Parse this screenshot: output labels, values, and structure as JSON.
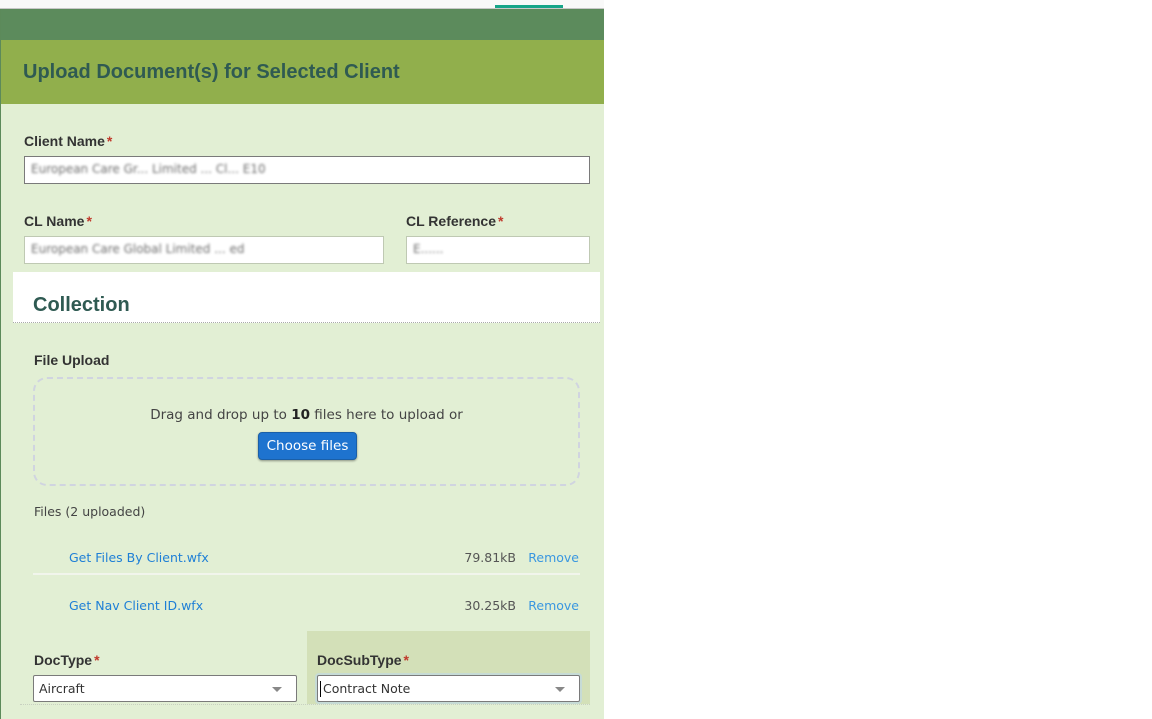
{
  "header": {
    "title": "Upload Document(s) for Selected Client"
  },
  "client": {
    "client_name_label": "Client Name",
    "client_name_value": "European Care Gr... Limited ... Cl... E10",
    "cl_name_label": "CL Name",
    "cl_name_value": "European Care Global Limited ... ed",
    "cl_reference_label": "CL Reference",
    "cl_reference_value": "E......",
    "required_marker": "*"
  },
  "collection": {
    "title": "Collection",
    "file_upload_label": "File Upload",
    "dropzone": {
      "text_before": "Drag and drop up to ",
      "max_files": "10",
      "text_after": " files here to upload or",
      "button_label": "Choose files"
    },
    "files_count_label": "Files (2 uploaded)",
    "files": [
      {
        "name": "Get Files By Client.wfx",
        "size": "79.81kB",
        "action": "Remove"
      },
      {
        "name": "Get Nav Client ID.wfx",
        "size": "30.25kB",
        "action": "Remove"
      }
    ]
  },
  "doc": {
    "doctype_label": "DocType",
    "doctype_value": "Aircraft",
    "docsubtype_label": "DocSubType",
    "docsubtype_value": "Contract Note"
  },
  "colors": {
    "header_dark": "#5c8b5c",
    "header_accent": "#91af4c",
    "panel_bg": "#e2efd4",
    "title_text": "#2f5a52",
    "button_blue": "#1e73cf",
    "link_blue": "#1e7fd6",
    "tab_indicator": "#17a589"
  }
}
